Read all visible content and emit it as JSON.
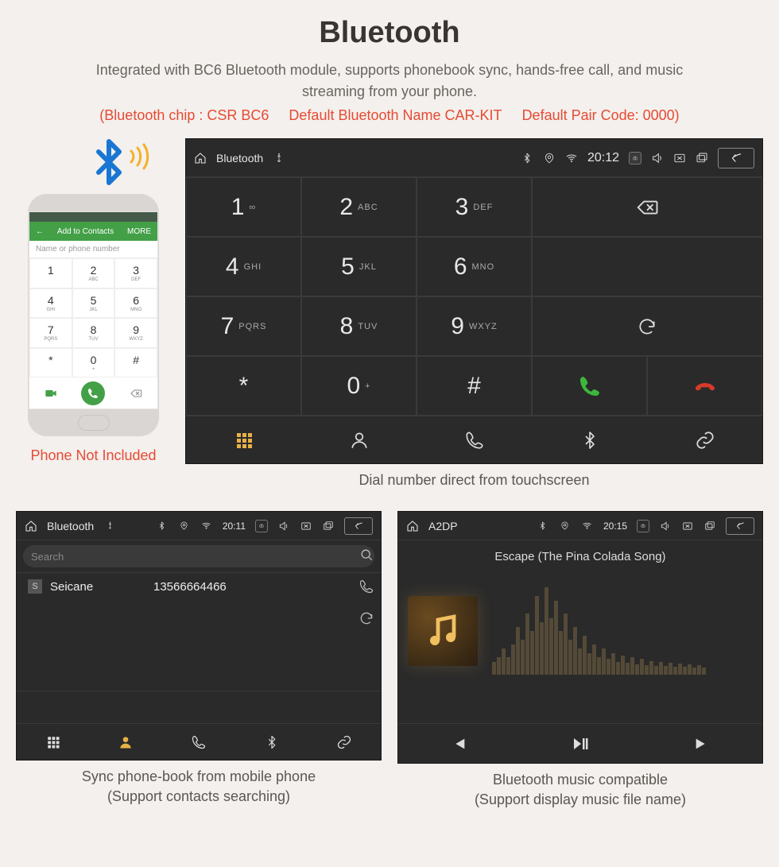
{
  "header": {
    "title": "Bluetooth",
    "subtitle": "Integrated with BC6 Bluetooth module, supports phonebook sync, hands-free call, and music streaming from your phone.",
    "note_chip": "(Bluetooth chip : CSR BC6",
    "note_name": "Default Bluetooth Name CAR-KIT",
    "note_code": "Default Pair Code: 0000)"
  },
  "phone": {
    "bar_left": "←",
    "bar_label": "Add to Contacts",
    "bar_right": "MORE",
    "placeholder": "Name or phone number",
    "keys": [
      {
        "n": "1",
        "s": ""
      },
      {
        "n": "2",
        "s": "ABC"
      },
      {
        "n": "3",
        "s": "DEF"
      },
      {
        "n": "4",
        "s": "GHI"
      },
      {
        "n": "5",
        "s": "JKL"
      },
      {
        "n": "6",
        "s": "MNO"
      },
      {
        "n": "7",
        "s": "PQRS"
      },
      {
        "n": "8",
        "s": "TUV"
      },
      {
        "n": "9",
        "s": "WXYZ"
      },
      {
        "n": "*",
        "s": ""
      },
      {
        "n": "0",
        "s": "+"
      },
      {
        "n": "#",
        "s": ""
      }
    ],
    "caption": "Phone Not Included"
  },
  "dialer": {
    "status": {
      "app": "Bluetooth",
      "time": "20:12"
    },
    "keys": [
      {
        "n": "1",
        "s": "∞"
      },
      {
        "n": "2",
        "s": "ABC"
      },
      {
        "n": "3",
        "s": "DEF"
      },
      {
        "n": "4",
        "s": "GHI"
      },
      {
        "n": "5",
        "s": "JKL"
      },
      {
        "n": "6",
        "s": "MNO"
      },
      {
        "n": "7",
        "s": "PQRS"
      },
      {
        "n": "8",
        "s": "TUV"
      },
      {
        "n": "9",
        "s": "WXYZ"
      },
      {
        "n": "*",
        "s": ""
      },
      {
        "n": "0",
        "s": "+"
      },
      {
        "n": "#",
        "s": ""
      }
    ],
    "caption": "Dial number direct from touchscreen"
  },
  "contacts": {
    "status": {
      "app": "Bluetooth",
      "time": "20:11"
    },
    "search_placeholder": "Search",
    "rows": [
      {
        "initial": "S",
        "name": "Seicane",
        "number": "13566664466"
      }
    ],
    "caption_line1": "Sync phone-book from mobile phone",
    "caption_line2": "(Support contacts searching)"
  },
  "music": {
    "status": {
      "app": "A2DP",
      "time": "20:15"
    },
    "track": "Escape (The Pina Colada Song)",
    "caption_line1": "Bluetooth music compatible",
    "caption_line2": "(Support display music file name)"
  }
}
